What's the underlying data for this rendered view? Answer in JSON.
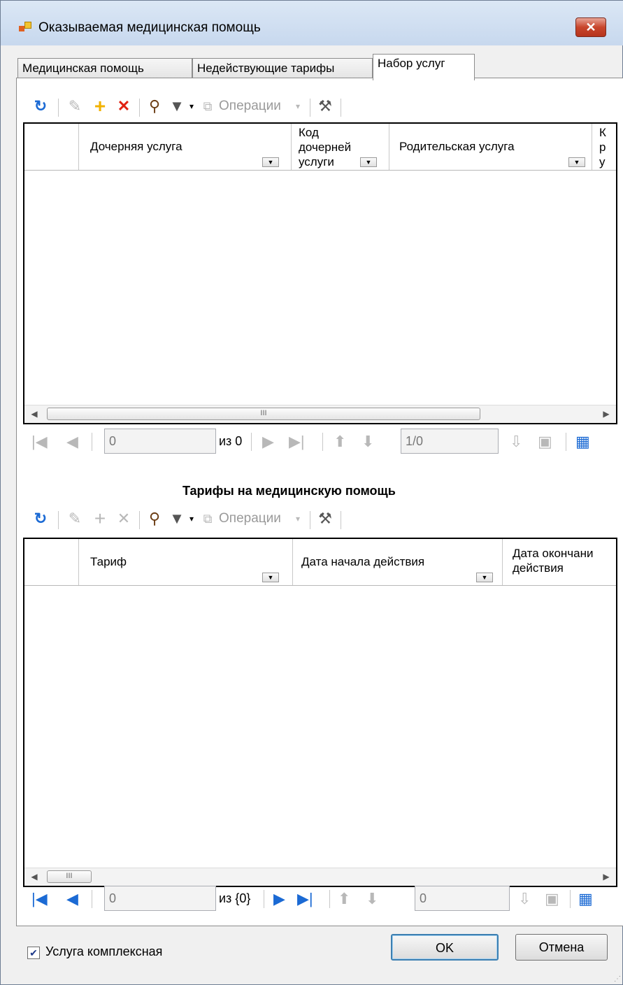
{
  "window": {
    "title": "Оказываемая медицинская помощь",
    "close_glyph": "✕"
  },
  "tabs": [
    {
      "label": "Медицинская помощь"
    },
    {
      "label": "Недействующие тарифы"
    },
    {
      "label": "Набор услуг"
    }
  ],
  "toolbar1": {
    "operations_label": "Операции"
  },
  "grid1": {
    "columns": [
      {
        "label": "Дочерняя услуга"
      },
      {
        "label": "Код дочерней услуги"
      },
      {
        "label": "Родительская услуга"
      },
      {
        "label": "К р у"
      }
    ]
  },
  "nav1": {
    "position": "0",
    "of_label": "из 0",
    "page": "1/0"
  },
  "section2": {
    "title": "Тарифы на медицинскую помощь"
  },
  "toolbar2": {
    "operations_label": "Операции"
  },
  "grid2": {
    "columns": [
      {
        "label": "Тариф"
      },
      {
        "label": "Дата начала действия"
      },
      {
        "label": "Дата окончани действия"
      }
    ]
  },
  "nav2": {
    "position": "0",
    "of_label": "из {0}",
    "page": "0"
  },
  "footer": {
    "complex_checkbox_label": "Услуга комплексная",
    "complex_checked": true,
    "ok_label": "OK",
    "cancel_label": "Отмена"
  },
  "colors": {
    "title_bg": "#c7d8ee",
    "close_red": "#c8452c",
    "nav_blue": "#1b6ad4",
    "add_yellow": "#f2b200",
    "delete_red": "#e02010"
  }
}
